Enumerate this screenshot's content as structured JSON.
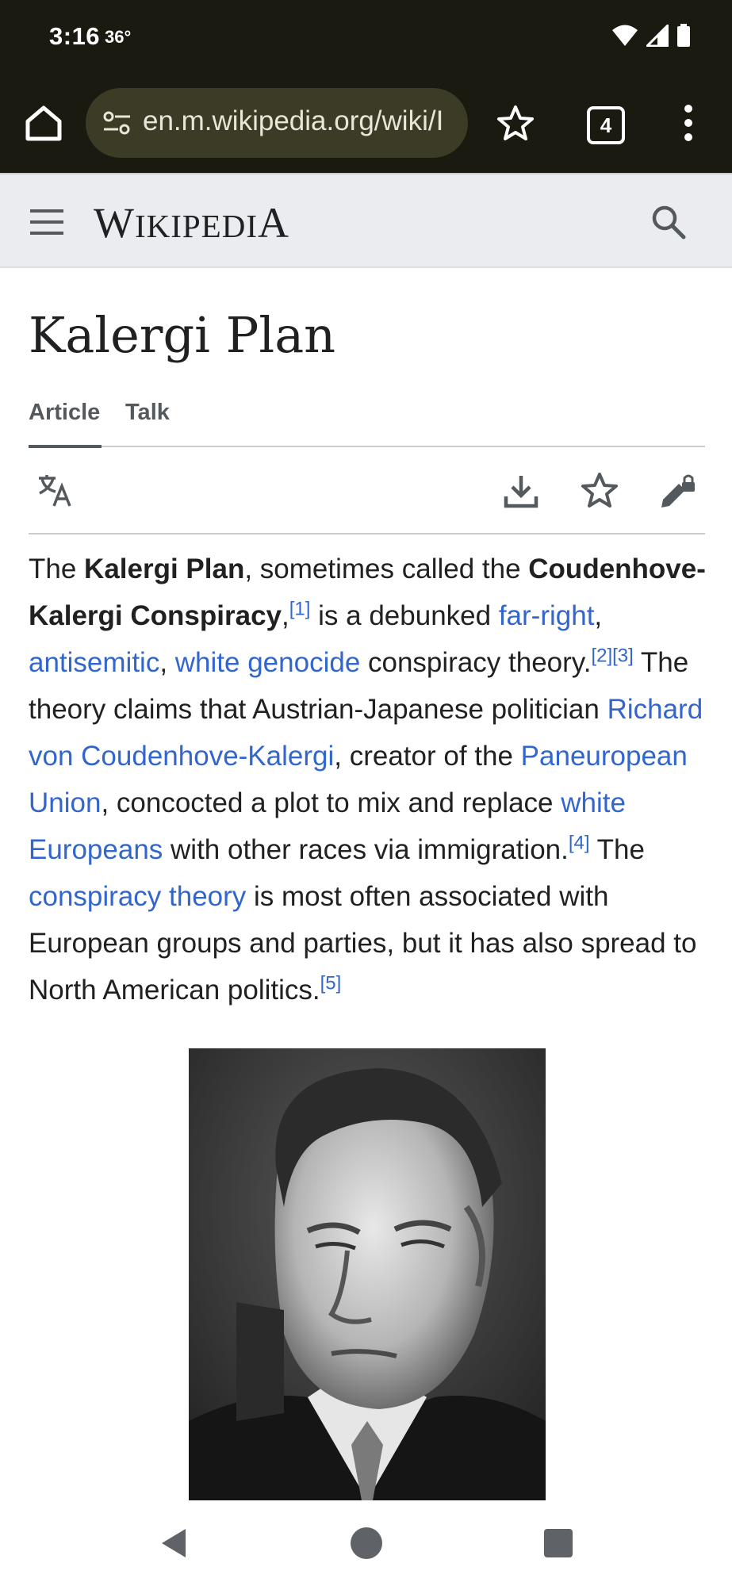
{
  "status_bar": {
    "time": "3:16",
    "temperature": "36°"
  },
  "browser": {
    "url": "en.m.wikipedia.org/wiki/I",
    "tab_count": "4"
  },
  "wiki_header": {
    "wordmark_big_w": "W",
    "wordmark_rest": "IKIPEDI",
    "wordmark_big_a": "A"
  },
  "page": {
    "title": "Kalergi Plan",
    "tabs": [
      {
        "label": "Article"
      },
      {
        "label": "Talk"
      }
    ]
  },
  "article": {
    "t01": "The ",
    "b01": "Kalergi Plan",
    "t02": ", sometimes called the ",
    "b02": "Coudenhove-Kalergi Conspiracy",
    "t03": ",",
    "ref1": "[1]",
    "t04": " is a debunked ",
    "l01": "far-right",
    "t05": ", ",
    "l02": "antisemitic",
    "t06": ", ",
    "l03": "white genocide",
    "t07": " conspiracy theory.",
    "ref2": "[2]",
    "ref3": "[3]",
    "t08": " The theory claims that Austrian-Japanese politician ",
    "l04": "Richard von Coudenhove-Kalergi",
    "t09": ", creator of the ",
    "l05": "Paneuropean Union",
    "t10": ", concocted a plot to mix and replace ",
    "l06": "white Europeans",
    "t11": " with other races via immigration.",
    "ref4": "[4]",
    "t12": " The ",
    "l07": "conspiracy theory",
    "t13": " is most often associated with European groups and parties, but it has also spread to North American politics.",
    "ref5": "[5]"
  },
  "colors": {
    "link": "#3366cc",
    "text": "#202122",
    "header_bg": "#eaecf0",
    "system_bar": "#1b1a10"
  }
}
